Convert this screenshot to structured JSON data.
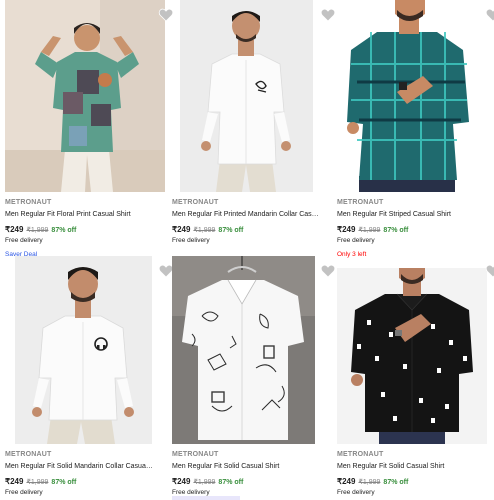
{
  "products": [
    {
      "brand": "METRONAUT",
      "title": "Men Regular Fit Floral Print Casual Shirt",
      "price": "₹249",
      "mrp": "₹1,999",
      "discount": "87% off",
      "delivery": "Free delivery",
      "extra": "Saver Deal"
    },
    {
      "brand": "METRONAUT",
      "title": "Men Regular Fit Printed Mandarin Collar Casual Shirt",
      "price": "₹249",
      "mrp": "₹1,999",
      "discount": "87% off",
      "delivery": "Free delivery",
      "extra": ""
    },
    {
      "brand": "METRONAUT",
      "title": "Men Regular Fit Striped Casual Shirt",
      "price": "₹249",
      "mrp": "₹1,999",
      "discount": "87% off",
      "delivery": "Free delivery",
      "extra": "Only 3 left"
    },
    {
      "brand": "METRONAUT",
      "title": "Men Regular Fit Solid Mandarin Collar Casual Shirt",
      "price": "₹249",
      "mrp": "₹1,999",
      "discount": "87% off",
      "delivery": "Free delivery",
      "extra": ""
    },
    {
      "brand": "METRONAUT",
      "title": "Men Regular Fit Solid Casual Shirt",
      "price": "₹249",
      "mrp": "₹1,999",
      "discount": "87% off",
      "delivery": "Free delivery",
      "extra": ""
    },
    {
      "brand": "METRONAUT",
      "title": "Men Regular Fit Solid Casual Shirt",
      "price": "₹249",
      "mrp": "₹1,999",
      "discount": "87% off",
      "delivery": "Free delivery",
      "extra": ""
    }
  ],
  "colors": {
    "discount_green": "#388e3c",
    "saver_deal_blue": "#2a55e5",
    "low_stock_red": "#ff0000",
    "wishlist_heart": "#c2c2c2"
  },
  "icons": [
    "heart-icon"
  ]
}
